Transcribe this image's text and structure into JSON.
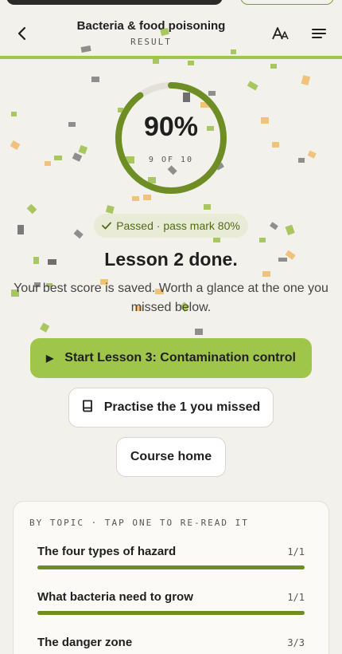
{
  "header": {
    "title": "Bacteria & food poisoning",
    "subtitle": "RESULT",
    "back_icon": "chevron-left-icon",
    "text_size_icon": "text-size-icon",
    "menu_icon": "hamburger-menu-icon"
  },
  "result": {
    "score": "90%",
    "score_fraction": 0.9,
    "of_text": "9 OF 10",
    "pass_text": "Passed · pass mark 80%",
    "heading": "Lesson 2 done.",
    "message": "Your best score is saved. Worth a glance at the one you missed below."
  },
  "actions": {
    "next_lesson": "Start Lesson 3: Contamination control",
    "practise": "Practise the 1 you missed",
    "course_home": "Course home"
  },
  "topics": {
    "heading": "BY TOPIC · TAP ONE TO RE-READ IT",
    "items": [
      {
        "label": "The four types of hazard",
        "score": "1/1",
        "fraction": 1
      },
      {
        "label": "What bacteria need to grow",
        "score": "1/1",
        "fraction": 1
      },
      {
        "label": "The danger zone",
        "score": "3/3",
        "fraction": 1
      }
    ]
  },
  "colors": {
    "accent": "#9fc54a",
    "accent_dark": "#6e8e25",
    "background": "#f3f1ec"
  }
}
